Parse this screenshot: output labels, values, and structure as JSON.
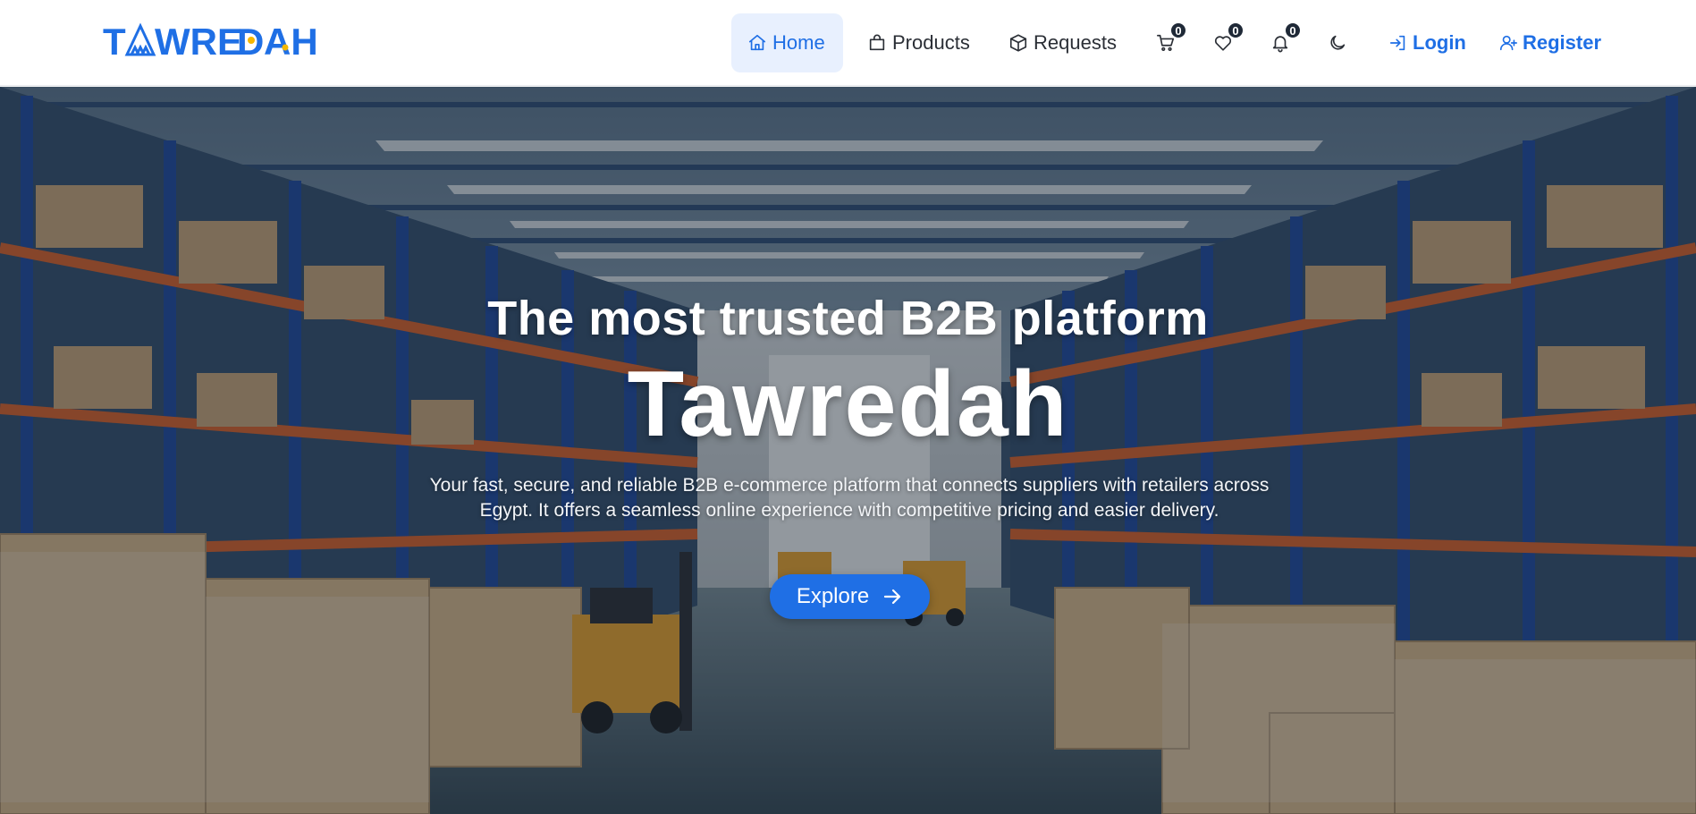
{
  "brand": {
    "logo_text": "TAWREDAH",
    "primary_color": "#1f6fe5",
    "accent_color": "#f5b700"
  },
  "nav": {
    "links": [
      {
        "label": "Home",
        "icon": "home-icon",
        "active": true
      },
      {
        "label": "Products",
        "icon": "shopping-bag-icon",
        "active": false
      },
      {
        "label": "Requests",
        "icon": "box-icon",
        "active": false
      }
    ],
    "cart_count": "0",
    "wishlist_count": "0",
    "notifications_count": "0",
    "theme_icon": "moon-icon",
    "login_label": "Login",
    "register_label": "Register"
  },
  "hero": {
    "subtitle": "The most trusted B2B platform",
    "title": "Tawredah",
    "description": "Your fast, secure, and reliable B2B e-commerce platform that connects suppliers with retailers across Egypt. It offers a seamless online experience with competitive pricing and easier delivery.",
    "cta_label": "Explore",
    "background": "warehouse-photo"
  }
}
